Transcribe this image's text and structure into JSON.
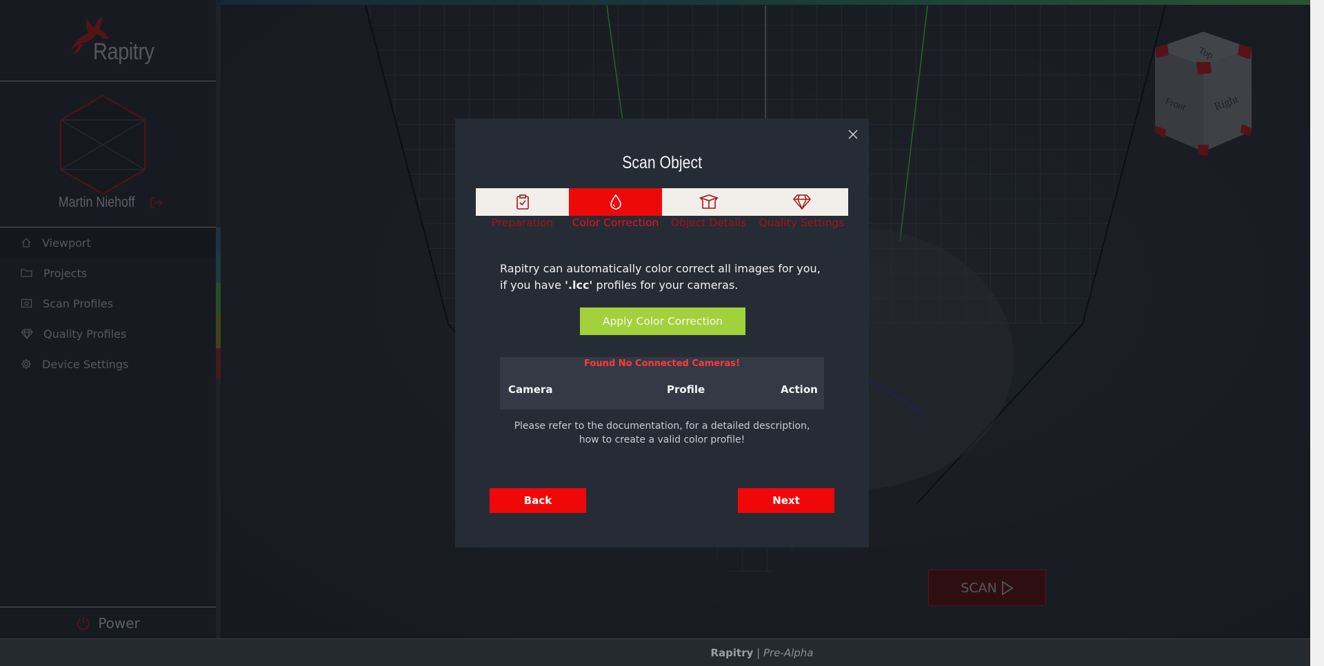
{
  "app": {
    "name": "Rapitry"
  },
  "user": {
    "name": "Martin Niehoff"
  },
  "sidebar": {
    "items": [
      {
        "label": "Viewport",
        "icon": "home-icon"
      },
      {
        "label": "Projects",
        "icon": "folder-icon"
      },
      {
        "label": "Scan Profiles",
        "icon": "camera-box-icon"
      },
      {
        "label": "Quality Profiles",
        "icon": "diamond-icon"
      },
      {
        "label": "Device Settings",
        "icon": "gear-icon"
      }
    ],
    "power_label": "Power"
  },
  "viewport": {
    "scan_label": "SCAN",
    "cube_faces": [
      "Top",
      "Front",
      "Right"
    ]
  },
  "modal": {
    "title": "Scan Object",
    "steps": [
      {
        "label": "Preparation",
        "icon": "clipboard-check-icon"
      },
      {
        "label": "Color Correction",
        "icon": "droplet-icon",
        "active": true
      },
      {
        "label": "Object Details",
        "icon": "box-icon"
      },
      {
        "label": "Quality Settings",
        "icon": "diamond-icon"
      }
    ],
    "intro_line1": "Rapitry can automatically color correct all images for you,",
    "intro_line2_prefix": "if you have ",
    "intro_line2_bold": "'.lcc'",
    "intro_line2_suffix": " profiles for your cameras.",
    "apply_label": "Apply Color Correction",
    "warning": "Found No Connected Cameras!",
    "table_headers": [
      "Camera",
      "Profile",
      "Action"
    ],
    "note_line1": "Please refer to the documentation, for a detailed description,",
    "note_line2": "how to create a valid color profile!",
    "back_label": "Back",
    "next_label": "Next"
  },
  "footer": {
    "brand": "Rapitry",
    "separator": " | ",
    "stage": "Pre-Alpha"
  },
  "colors": {
    "accent": "#f00808",
    "apply_green": "#a1d23c",
    "sidebar_bg": "#1e232a",
    "modal_bg": "#262c36"
  }
}
